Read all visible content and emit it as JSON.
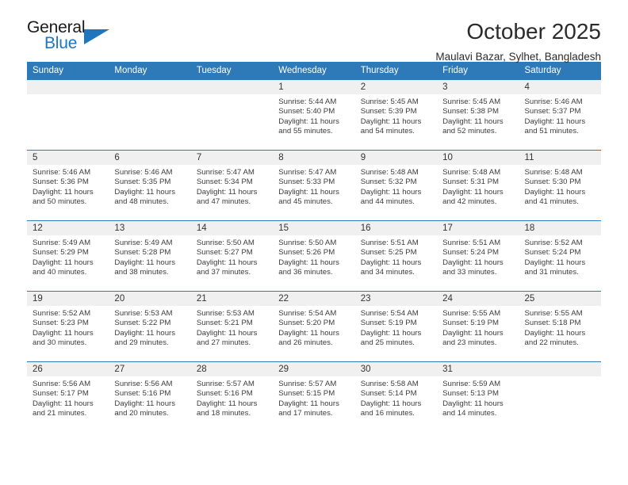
{
  "brand": {
    "name_top": "General",
    "name_bottom": "Blue",
    "accent_color": "#1f76bc",
    "triangle_icon": "brand-triangle-icon"
  },
  "header": {
    "title": "October 2025",
    "subtitle": "Maulavi Bazar, Sylhet, Bangladesh"
  },
  "theme": {
    "header_row_bg": "#2e7ab8",
    "daynum_bg": "#f0f0f0",
    "cell_border": "#2e7ab8",
    "text": "#3c3c3c"
  },
  "weekdays": [
    "Sunday",
    "Monday",
    "Tuesday",
    "Wednesday",
    "Thursday",
    "Friday",
    "Saturday"
  ],
  "calendar": {
    "month": "October",
    "year": 2025,
    "weeks": [
      [
        {
          "day": "",
          "lines": []
        },
        {
          "day": "",
          "lines": []
        },
        {
          "day": "",
          "lines": []
        },
        {
          "day": "1",
          "lines": [
            "Sunrise: 5:44 AM",
            "Sunset: 5:40 PM",
            "Daylight: 11 hours",
            "and 55 minutes."
          ]
        },
        {
          "day": "2",
          "lines": [
            "Sunrise: 5:45 AM",
            "Sunset: 5:39 PM",
            "Daylight: 11 hours",
            "and 54 minutes."
          ]
        },
        {
          "day": "3",
          "lines": [
            "Sunrise: 5:45 AM",
            "Sunset: 5:38 PM",
            "Daylight: 11 hours",
            "and 52 minutes."
          ]
        },
        {
          "day": "4",
          "lines": [
            "Sunrise: 5:46 AM",
            "Sunset: 5:37 PM",
            "Daylight: 11 hours",
            "and 51 minutes."
          ]
        }
      ],
      [
        {
          "day": "5",
          "lines": [
            "Sunrise: 5:46 AM",
            "Sunset: 5:36 PM",
            "Daylight: 11 hours",
            "and 50 minutes."
          ]
        },
        {
          "day": "6",
          "lines": [
            "Sunrise: 5:46 AM",
            "Sunset: 5:35 PM",
            "Daylight: 11 hours",
            "and 48 minutes."
          ]
        },
        {
          "day": "7",
          "lines": [
            "Sunrise: 5:47 AM",
            "Sunset: 5:34 PM",
            "Daylight: 11 hours",
            "and 47 minutes."
          ]
        },
        {
          "day": "8",
          "lines": [
            "Sunrise: 5:47 AM",
            "Sunset: 5:33 PM",
            "Daylight: 11 hours",
            "and 45 minutes."
          ]
        },
        {
          "day": "9",
          "lines": [
            "Sunrise: 5:48 AM",
            "Sunset: 5:32 PM",
            "Daylight: 11 hours",
            "and 44 minutes."
          ]
        },
        {
          "day": "10",
          "lines": [
            "Sunrise: 5:48 AM",
            "Sunset: 5:31 PM",
            "Daylight: 11 hours",
            "and 42 minutes."
          ]
        },
        {
          "day": "11",
          "lines": [
            "Sunrise: 5:48 AM",
            "Sunset: 5:30 PM",
            "Daylight: 11 hours",
            "and 41 minutes."
          ]
        }
      ],
      [
        {
          "day": "12",
          "lines": [
            "Sunrise: 5:49 AM",
            "Sunset: 5:29 PM",
            "Daylight: 11 hours",
            "and 40 minutes."
          ]
        },
        {
          "day": "13",
          "lines": [
            "Sunrise: 5:49 AM",
            "Sunset: 5:28 PM",
            "Daylight: 11 hours",
            "and 38 minutes."
          ]
        },
        {
          "day": "14",
          "lines": [
            "Sunrise: 5:50 AM",
            "Sunset: 5:27 PM",
            "Daylight: 11 hours",
            "and 37 minutes."
          ]
        },
        {
          "day": "15",
          "lines": [
            "Sunrise: 5:50 AM",
            "Sunset: 5:26 PM",
            "Daylight: 11 hours",
            "and 36 minutes."
          ]
        },
        {
          "day": "16",
          "lines": [
            "Sunrise: 5:51 AM",
            "Sunset: 5:25 PM",
            "Daylight: 11 hours",
            "and 34 minutes."
          ]
        },
        {
          "day": "17",
          "lines": [
            "Sunrise: 5:51 AM",
            "Sunset: 5:24 PM",
            "Daylight: 11 hours",
            "and 33 minutes."
          ]
        },
        {
          "day": "18",
          "lines": [
            "Sunrise: 5:52 AM",
            "Sunset: 5:24 PM",
            "Daylight: 11 hours",
            "and 31 minutes."
          ]
        }
      ],
      [
        {
          "day": "19",
          "lines": [
            "Sunrise: 5:52 AM",
            "Sunset: 5:23 PM",
            "Daylight: 11 hours",
            "and 30 minutes."
          ]
        },
        {
          "day": "20",
          "lines": [
            "Sunrise: 5:53 AM",
            "Sunset: 5:22 PM",
            "Daylight: 11 hours",
            "and 29 minutes."
          ]
        },
        {
          "day": "21",
          "lines": [
            "Sunrise: 5:53 AM",
            "Sunset: 5:21 PM",
            "Daylight: 11 hours",
            "and 27 minutes."
          ]
        },
        {
          "day": "22",
          "lines": [
            "Sunrise: 5:54 AM",
            "Sunset: 5:20 PM",
            "Daylight: 11 hours",
            "and 26 minutes."
          ]
        },
        {
          "day": "23",
          "lines": [
            "Sunrise: 5:54 AM",
            "Sunset: 5:19 PM",
            "Daylight: 11 hours",
            "and 25 minutes."
          ]
        },
        {
          "day": "24",
          "lines": [
            "Sunrise: 5:55 AM",
            "Sunset: 5:19 PM",
            "Daylight: 11 hours",
            "and 23 minutes."
          ]
        },
        {
          "day": "25",
          "lines": [
            "Sunrise: 5:55 AM",
            "Sunset: 5:18 PM",
            "Daylight: 11 hours",
            "and 22 minutes."
          ]
        }
      ],
      [
        {
          "day": "26",
          "lines": [
            "Sunrise: 5:56 AM",
            "Sunset: 5:17 PM",
            "Daylight: 11 hours",
            "and 21 minutes."
          ]
        },
        {
          "day": "27",
          "lines": [
            "Sunrise: 5:56 AM",
            "Sunset: 5:16 PM",
            "Daylight: 11 hours",
            "and 20 minutes."
          ]
        },
        {
          "day": "28",
          "lines": [
            "Sunrise: 5:57 AM",
            "Sunset: 5:16 PM",
            "Daylight: 11 hours",
            "and 18 minutes."
          ]
        },
        {
          "day": "29",
          "lines": [
            "Sunrise: 5:57 AM",
            "Sunset: 5:15 PM",
            "Daylight: 11 hours",
            "and 17 minutes."
          ]
        },
        {
          "day": "30",
          "lines": [
            "Sunrise: 5:58 AM",
            "Sunset: 5:14 PM",
            "Daylight: 11 hours",
            "and 16 minutes."
          ]
        },
        {
          "day": "31",
          "lines": [
            "Sunrise: 5:59 AM",
            "Sunset: 5:13 PM",
            "Daylight: 11 hours",
            "and 14 minutes."
          ]
        },
        {
          "day": "",
          "lines": []
        }
      ]
    ]
  }
}
